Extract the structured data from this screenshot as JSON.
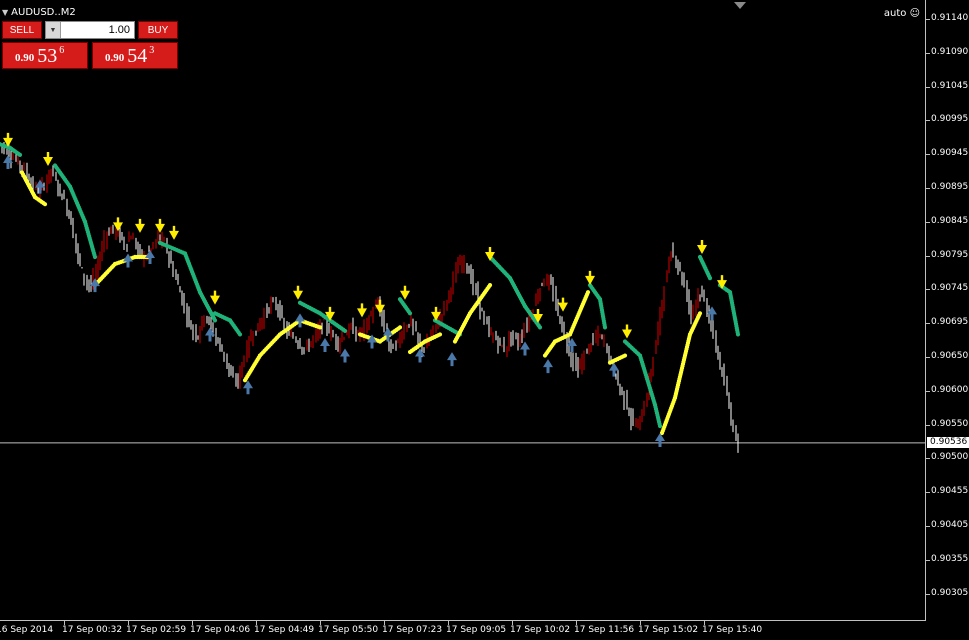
{
  "symbol": {
    "title": "AUDUSD..M2",
    "menu_icon": "triangle-down-icon"
  },
  "auto_label": "auto",
  "auto_icon": "smiley-icon",
  "trade_panel": {
    "sell_label": "SELL",
    "buy_label": "BUY",
    "lot_value": "1.00",
    "sell_price": {
      "prefix": "0.90",
      "main": "53",
      "sup": "6"
    },
    "buy_price": {
      "prefix": "0.90",
      "main": "54",
      "sup": "3"
    }
  },
  "colors": {
    "background": "#000000",
    "bull_candle": "#d40000",
    "bear_candle": "#ffffff",
    "trend_up": "#ffff33",
    "trend_down": "#1fb37a",
    "arrow_down": "#ffee00",
    "arrow_up": "#4a78a8",
    "price_line": "#c0c0c0"
  },
  "y_axis": {
    "ticks": [
      "0.91140",
      "0.91090",
      "0.91045",
      "0.90995",
      "0.90945",
      "0.90895",
      "0.90845",
      "0.90795",
      "0.90745",
      "0.90695",
      "0.90650",
      "0.90600",
      "0.90550",
      "0.90500",
      "0.90455",
      "0.90405",
      "0.90355",
      "0.90305"
    ],
    "current_price": "0.90536"
  },
  "x_axis": {
    "ticks": [
      "16 Sep 2014",
      "17 Sep 00:32",
      "17 Sep 02:59",
      "17 Sep 04:06",
      "17 Sep 04:49",
      "17 Sep 05:50",
      "17 Sep 07:23",
      "17 Sep 09:05",
      "17 Sep 10:02",
      "17 Sep 11:56",
      "17 Sep 15:02",
      "17 Sep 15:40"
    ]
  },
  "chart_data": {
    "type": "candlestick",
    "ylim": [
      0.90283,
      0.91165
    ],
    "current_price": 0.90536,
    "price_path": [
      0.90962,
      0.90958,
      0.90945,
      0.90935,
      0.90925,
      0.90905,
      0.90895,
      0.90905,
      0.90925,
      0.909,
      0.9088,
      0.9085,
      0.908,
      0.9077,
      0.9076,
      0.9079,
      0.9083,
      0.9084,
      0.90835,
      0.9082,
      0.9083,
      0.9081,
      0.908,
      0.9081,
      0.9083,
      0.9082,
      0.9079,
      0.9076,
      0.9073,
      0.907,
      0.9069,
      0.9072,
      0.907,
      0.9068,
      0.9066,
      0.9063,
      0.90625,
      0.9066,
      0.9069,
      0.907,
      0.9072,
      0.90735,
      0.9073,
      0.907,
      0.9069,
      0.9068,
      0.9067,
      0.9068,
      0.90695,
      0.9071,
      0.9069,
      0.9068,
      0.9069,
      0.907,
      0.9069,
      0.907,
      0.9072,
      0.90735,
      0.907,
      0.9067,
      0.9068,
      0.907,
      0.9071,
      0.9068,
      0.9067,
      0.9069,
      0.9071,
      0.9073,
      0.9076,
      0.9079,
      0.90795,
      0.9077,
      0.9074,
      0.9071,
      0.9069,
      0.9068,
      0.9067,
      0.9069,
      0.9068,
      0.907,
      0.9072,
      0.9075,
      0.9077,
      0.9076,
      0.9072,
      0.9069,
      0.9066,
      0.9064,
      0.9066,
      0.9068,
      0.9069,
      0.9068,
      0.9065,
      0.9062,
      0.906,
      0.9057,
      0.9056,
      0.9059,
      0.9064,
      0.907,
      0.9076,
      0.9081,
      0.9079,
      0.9076,
      0.9072,
      0.9075,
      0.9074,
      0.907,
      0.9066,
      0.9062,
      0.9057,
      0.90536
    ],
    "trend_up_segments": [
      [
        [
          22,
          0.9092
        ],
        [
          35,
          0.90885
        ],
        [
          45,
          0.90875
        ]
      ],
      [
        [
          95,
          0.9076
        ],
        [
          115,
          0.9079
        ],
        [
          135,
          0.908
        ],
        [
          150,
          0.908
        ]
      ],
      [
        [
          245,
          0.90625
        ],
        [
          260,
          0.9066
        ],
        [
          280,
          0.9069
        ],
        [
          300,
          0.9071
        ],
        [
          320,
          0.907
        ]
      ],
      [
        [
          360,
          0.9069
        ],
        [
          380,
          0.9068
        ],
        [
          400,
          0.907
        ]
      ],
      [
        [
          410,
          0.90665
        ],
        [
          425,
          0.9068
        ],
        [
          440,
          0.9069
        ]
      ],
      [
        [
          455,
          0.9068
        ],
        [
          470,
          0.9072
        ],
        [
          490,
          0.9076
        ]
      ],
      [
        [
          545,
          0.9066
        ],
        [
          555,
          0.9068
        ],
        [
          570,
          0.9069
        ],
        [
          588,
          0.9075
        ]
      ],
      [
        [
          610,
          0.9065
        ],
        [
          625,
          0.9066
        ]
      ],
      [
        [
          662,
          0.9055
        ],
        [
          675,
          0.906
        ],
        [
          690,
          0.9069
        ],
        [
          700,
          0.9072
        ]
      ]
    ],
    "trend_down_segments": [
      [
        [
          0,
          0.9096
        ],
        [
          10,
          0.90955
        ],
        [
          20,
          0.90945
        ]
      ],
      [
        [
          55,
          0.9093
        ],
        [
          70,
          0.909
        ],
        [
          85,
          0.9085
        ],
        [
          95,
          0.908
        ]
      ],
      [
        [
          160,
          0.9082
        ],
        [
          185,
          0.90805
        ],
        [
          200,
          0.9075
        ],
        [
          215,
          0.9071
        ]
      ],
      [
        [
          215,
          0.9072
        ],
        [
          230,
          0.9071
        ],
        [
          240,
          0.9069
        ]
      ],
      [
        [
          300,
          0.90735
        ],
        [
          320,
          0.9072
        ],
        [
          345,
          0.90695
        ]
      ],
      [
        [
          400,
          0.9074
        ],
        [
          410,
          0.9072
        ]
      ],
      [
        [
          435,
          0.9071
        ],
        [
          460,
          0.9069
        ]
      ],
      [
        [
          490,
          0.908
        ],
        [
          510,
          0.9077
        ],
        [
          525,
          0.9073
        ],
        [
          540,
          0.907
        ]
      ],
      [
        [
          590,
          0.9076
        ],
        [
          600,
          0.9074
        ],
        [
          605,
          0.907
        ]
      ],
      [
        [
          625,
          0.9068
        ],
        [
          640,
          0.9066
        ],
        [
          655,
          0.9059
        ],
        [
          660,
          0.9056
        ]
      ],
      [
        [
          700,
          0.908
        ],
        [
          710,
          0.9077
        ]
      ],
      [
        [
          720,
          0.9076
        ],
        [
          730,
          0.9075
        ],
        [
          738,
          0.9069
        ]
      ]
    ],
    "down_arrows": [
      [
        8,
        0.90962
      ],
      [
        48,
        0.90935
      ],
      [
        118,
        0.90842
      ],
      [
        140,
        0.9084
      ],
      [
        160,
        0.9084
      ],
      [
        174,
        0.9083
      ],
      [
        215,
        0.90738
      ],
      [
        298,
        0.90745
      ],
      [
        330,
        0.90715
      ],
      [
        362,
        0.9072
      ],
      [
        380,
        0.90725
      ],
      [
        405,
        0.90745
      ],
      [
        436,
        0.90715
      ],
      [
        490,
        0.908
      ],
      [
        538,
        0.90712
      ],
      [
        563,
        0.90728
      ],
      [
        590,
        0.90766
      ],
      [
        627,
        0.9069
      ],
      [
        702,
        0.9081
      ],
      [
        722,
        0.9076
      ]
    ],
    "up_arrows": [
      [
        8,
        0.90935
      ],
      [
        40,
        0.909
      ],
      [
        95,
        0.9076
      ],
      [
        128,
        0.90795
      ],
      [
        150,
        0.908
      ],
      [
        210,
        0.9069
      ],
      [
        248,
        0.90615
      ],
      [
        300,
        0.9071
      ],
      [
        325,
        0.90675
      ],
      [
        345,
        0.9066
      ],
      [
        372,
        0.9068
      ],
      [
        388,
        0.9069
      ],
      [
        420,
        0.9066
      ],
      [
        452,
        0.90655
      ],
      [
        525,
        0.9067
      ],
      [
        548,
        0.90645
      ],
      [
        572,
        0.90675
      ],
      [
        614,
        0.9064
      ],
      [
        660,
        0.9054
      ],
      [
        712,
        0.9072
      ]
    ]
  }
}
